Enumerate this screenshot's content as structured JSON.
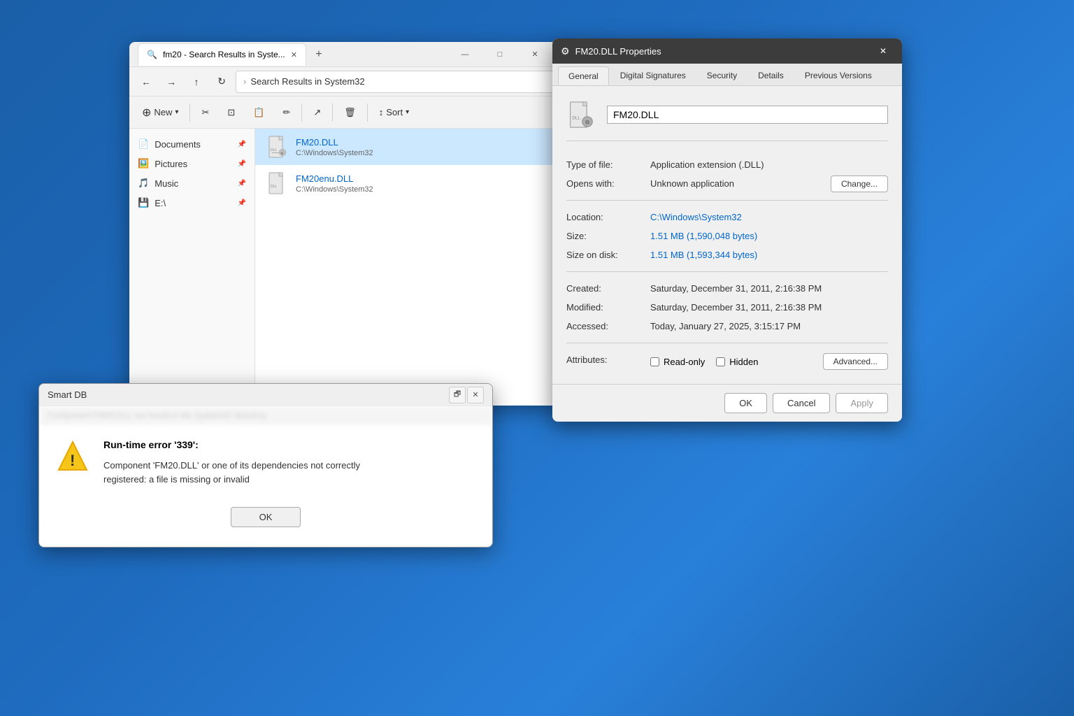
{
  "explorer": {
    "tab_title": "fm20 - Search Results in Syste...",
    "new_tab_btn": "+",
    "address": "Search Results in System32",
    "address_icon": "›",
    "toolbar_buttons": {
      "new": "New",
      "sort": "Sort"
    },
    "sidebar_items": [
      {
        "label": "Documents",
        "icon": "📄",
        "pinned": true
      },
      {
        "label": "Pictures",
        "icon": "🖼️",
        "pinned": true
      },
      {
        "label": "Music",
        "icon": "🎵",
        "pinned": true
      },
      {
        "label": "E:\\",
        "icon": "💾",
        "pinned": true
      }
    ],
    "files": [
      {
        "name": "FM20.DLL",
        "path": "C:\\Windows\\System32",
        "selected": true
      },
      {
        "name": "FM20enu.DLL",
        "path": "C:\\Windows\\System32",
        "selected": false
      }
    ]
  },
  "properties": {
    "title": "FM20.DLL Properties",
    "tabs": [
      "General",
      "Digital Signatures",
      "Security",
      "Details",
      "Previous Versions"
    ],
    "active_tab": "General",
    "filename": "FM20.DLL",
    "fields": {
      "type_label": "Type of file:",
      "type_value": "Application extension (.DLL)",
      "opens_label": "Opens with:",
      "opens_value": "Unknown application",
      "change_btn": "Change...",
      "location_label": "Location:",
      "location_value": "C:\\Windows\\System32",
      "size_label": "Size:",
      "size_value": "1.51 MB (1,590,048 bytes)",
      "size_on_disk_label": "Size on disk:",
      "size_on_disk_value": "1.51 MB (1,593,344 bytes)",
      "created_label": "Created:",
      "created_value": "Saturday, December 31, 2011, 2:16:38 PM",
      "modified_label": "Modified:",
      "modified_value": "Saturday, December 31, 2011, 2:16:38 PM",
      "accessed_label": "Accessed:",
      "accessed_value": "Today, January 27, 2025, 3:15:17 PM",
      "attributes_label": "Attributes:",
      "readonly_label": "Read-only",
      "hidden_label": "Hidden",
      "advanced_btn": "Advanced..."
    },
    "footer": {
      "ok": "OK",
      "cancel": "Cancel",
      "apply": "Apply"
    }
  },
  "error_dialog": {
    "title": "Smart DB",
    "close_icon": "✕",
    "restore_icon": "🗗",
    "title_text_blurred": "■■■■■■■ ■■ ■■■ ■■■■■■■■ ■■ ■■■ ■■■■■■",
    "error_title": "Run-time error '339':",
    "error_message": "Component 'FM20.DLL' or one of its dependencies not correctly\nregistered: a file is missing or invalid",
    "ok_btn": "OK"
  },
  "icons": {
    "back": "←",
    "forward": "→",
    "up": "↑",
    "refresh": "↻",
    "screen": "⊡",
    "cut": "✂",
    "copy": "⊡",
    "paste": "📋",
    "rename": "✏",
    "share": "↗",
    "delete": "🗑",
    "sort": "↕",
    "new_dropdown": "▾",
    "sort_dropdown": "▾",
    "pin": "📌",
    "search_small": "🔍",
    "close": "✕",
    "minimize": "—",
    "maximize": "□"
  }
}
